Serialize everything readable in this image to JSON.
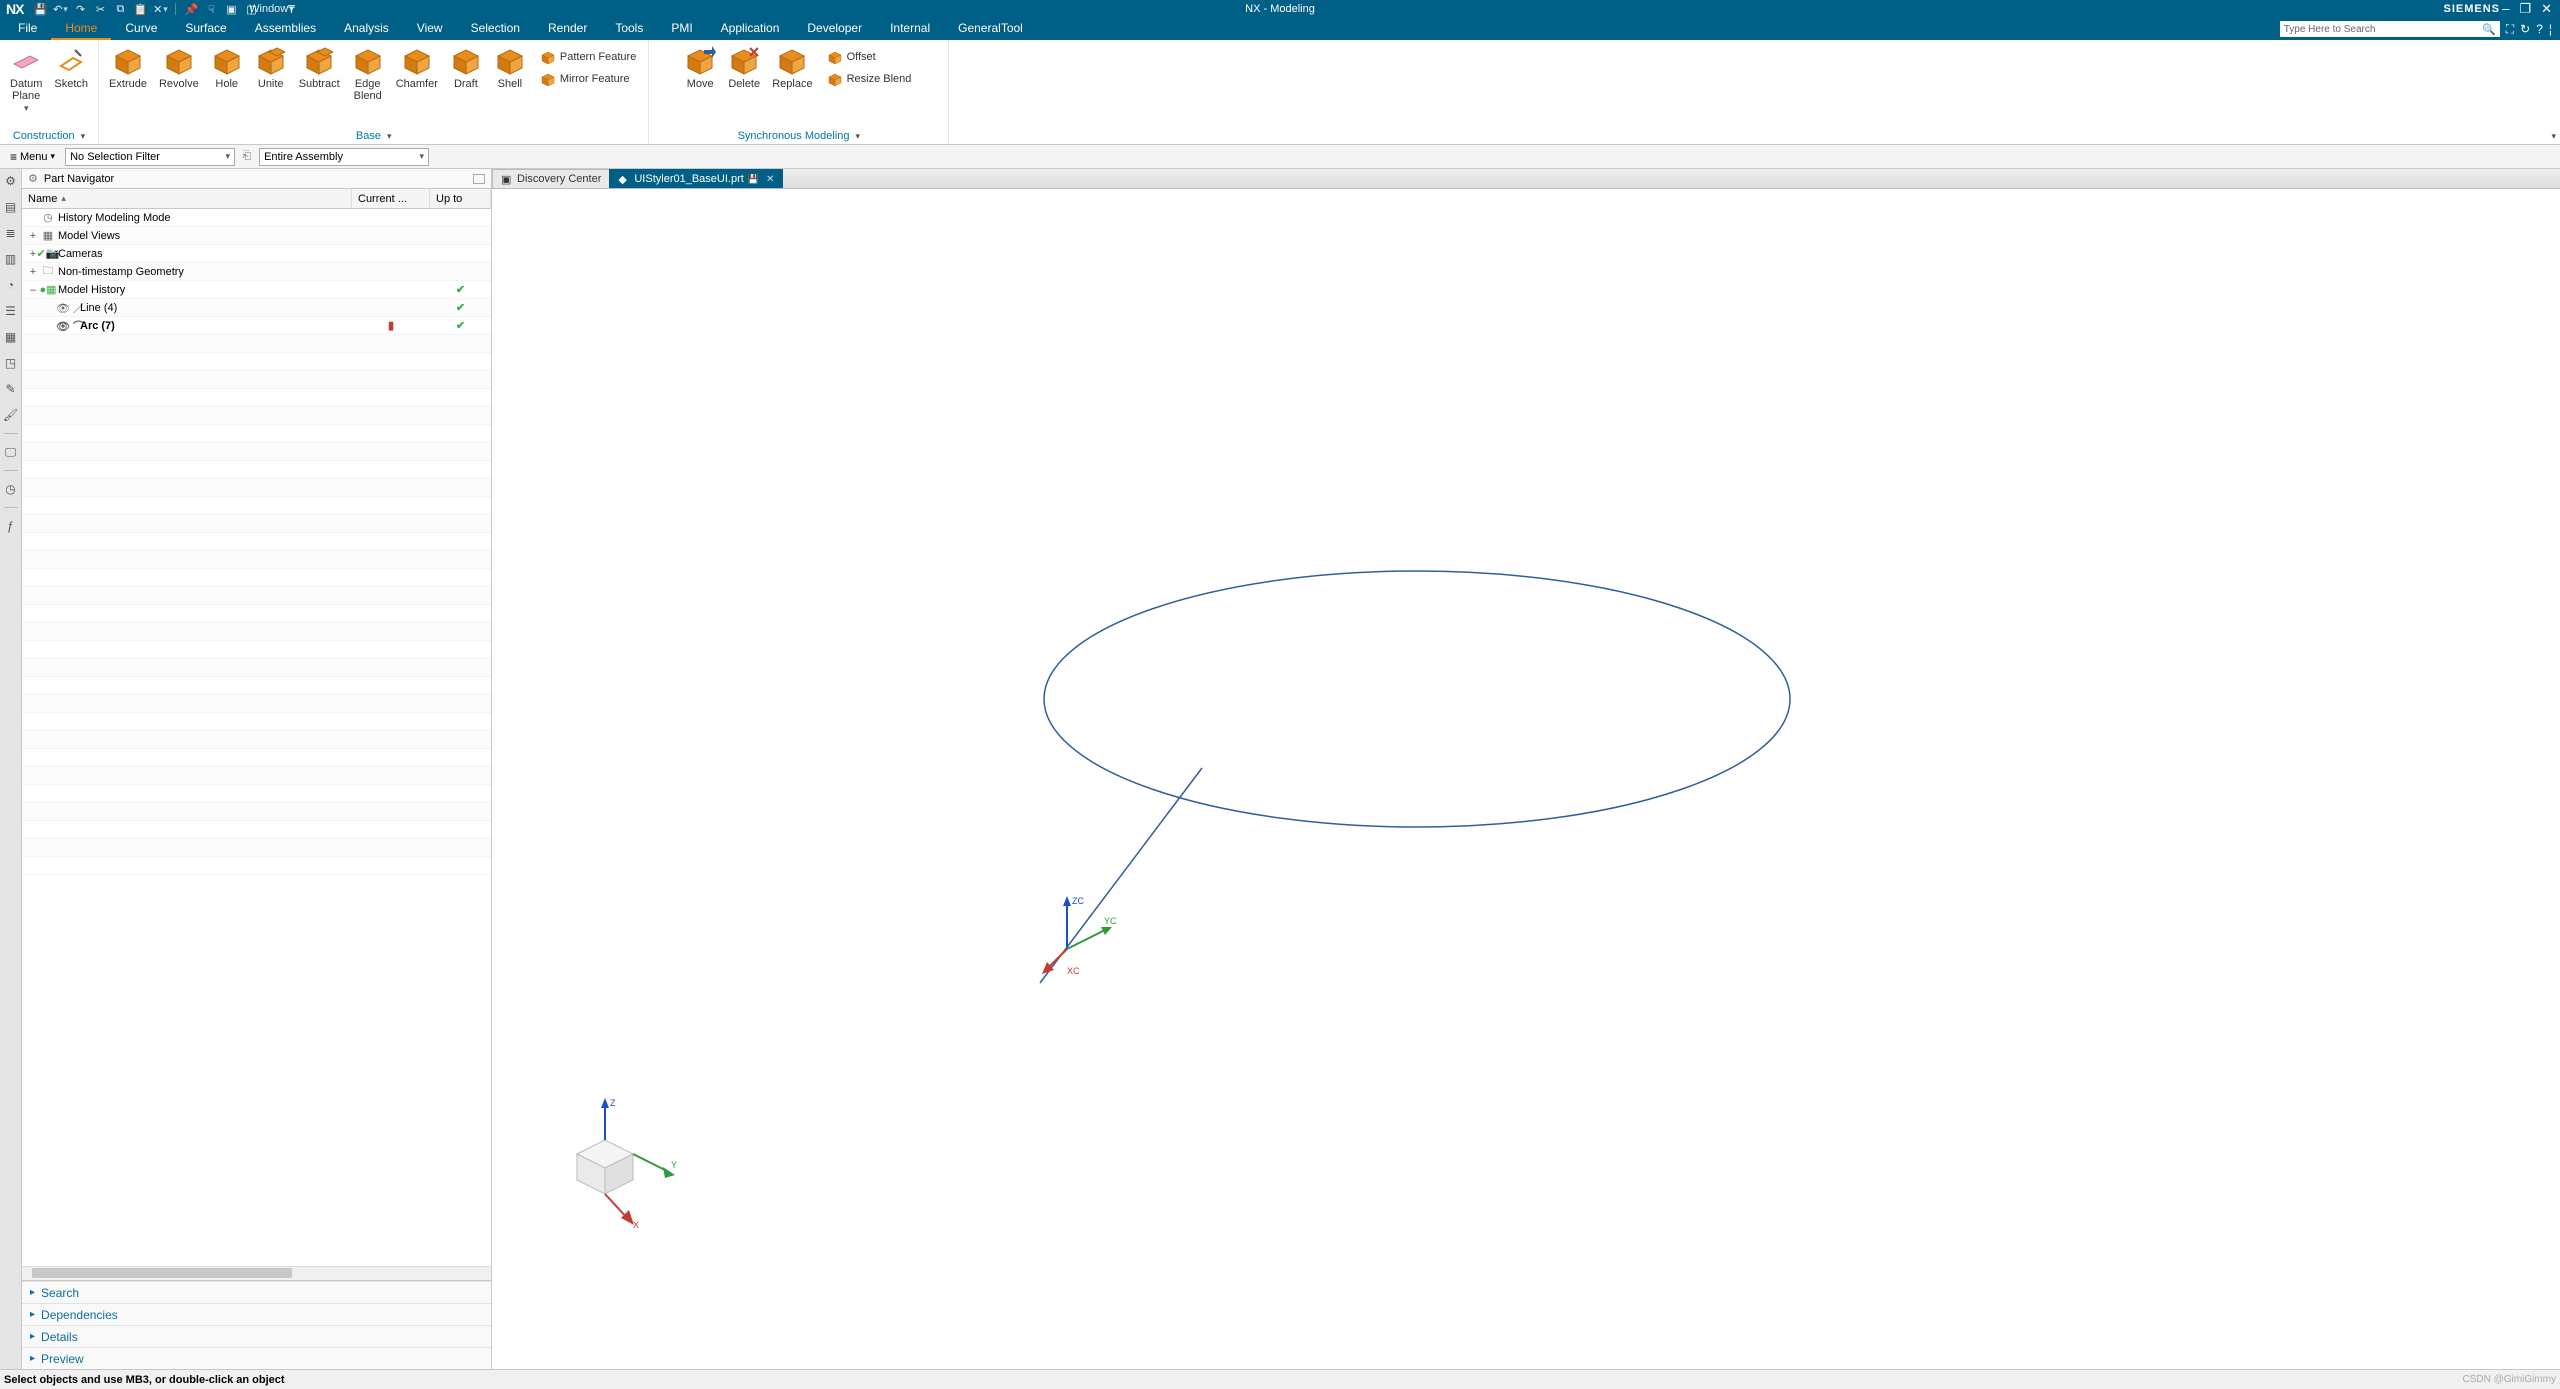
{
  "title_bar": {
    "app_logo": "NX",
    "qat": {
      "window_label": "Window",
      "icons": [
        "save-icon",
        "undo-icon",
        "redo-icon",
        "cut-icon",
        "copy-icon",
        "paste-icon",
        "close-x-icon",
        "sep",
        "pin-icon",
        "touch-icon",
        "layout1-icon",
        "layout2-icon"
      ]
    },
    "app_title": "NX - Modeling",
    "brand": "SIEMENS",
    "win_controls": [
      "–",
      "❐",
      "✕"
    ]
  },
  "menu_tabs": [
    "File",
    "Home",
    "Curve",
    "Surface",
    "Assemblies",
    "Analysis",
    "View",
    "Selection",
    "Render",
    "Tools",
    "PMI",
    "Application",
    "Developer",
    "Internal",
    "GeneralTool"
  ],
  "active_tab": "Home",
  "search": {
    "placeholder": "Type Here to Search"
  },
  "right_icons": [
    "fullscreen-icon",
    "recent-icon",
    "help-icon",
    "ham-menu-icon"
  ],
  "ribbon": {
    "groups": [
      {
        "name": "Construction",
        "label": "Construction",
        "large": [
          {
            "id": "datum-plane",
            "label": "Datum\nPlane",
            "caret": true,
            "style": "pink-plane"
          },
          {
            "id": "sketch",
            "label": "Sketch",
            "style": "sketch"
          }
        ]
      },
      {
        "name": "Base",
        "label": "Base",
        "large": [
          {
            "id": "extrude",
            "label": "Extrude",
            "style": "cube"
          },
          {
            "id": "revolve",
            "label": "Revolve",
            "style": "cube"
          },
          {
            "id": "hole",
            "label": "Hole",
            "style": "cube"
          },
          {
            "id": "unite",
            "label": "Unite",
            "style": "cubes"
          },
          {
            "id": "subtract",
            "label": "Subtract",
            "style": "cubes"
          },
          {
            "id": "edge-blend",
            "label": "Edge\nBlend",
            "style": "cube"
          },
          {
            "id": "chamfer",
            "label": "Chamfer",
            "style": "cube"
          },
          {
            "id": "draft",
            "label": "Draft",
            "style": "cube"
          },
          {
            "id": "shell",
            "label": "Shell",
            "style": "cube"
          }
        ],
        "small": [
          {
            "id": "pattern-feature",
            "label": "Pattern Feature"
          },
          {
            "id": "mirror-feature",
            "label": "Mirror Feature"
          }
        ]
      },
      {
        "name": "Synchronous",
        "label": "Synchronous Modeling",
        "large": [
          {
            "id": "move",
            "label": "Move",
            "style": "cube-arrow"
          },
          {
            "id": "delete",
            "label": "Delete",
            "style": "cube-x"
          },
          {
            "id": "replace",
            "label": "Replace",
            "style": "cube"
          }
        ],
        "small": [
          {
            "id": "offset",
            "label": "Offset"
          },
          {
            "id": "resize-blend",
            "label": "Resize Blend"
          }
        ]
      }
    ]
  },
  "filter_bar": {
    "menu": "Menu",
    "selection_filter": "No Selection Filter",
    "assembly_filter": "Entire Assembly"
  },
  "navigator": {
    "title": "Part Navigator",
    "columns": {
      "name": "Name",
      "current": "Current ...",
      "upto": "Up to"
    },
    "tree": [
      {
        "level": 0,
        "exp": "",
        "pre": "◷",
        "label": "History Modeling Mode",
        "check": ""
      },
      {
        "level": 0,
        "exp": "+",
        "pre": "▦",
        "label": "Model Views",
        "check": ""
      },
      {
        "level": 0,
        "exp": "+",
        "pre": "✔📷",
        "pre_color": "#3cb043",
        "label": "Cameras",
        "check": ""
      },
      {
        "level": 0,
        "exp": "+",
        "pre": "🗀",
        "label": "Non-timestamp Geometry",
        "check": ""
      },
      {
        "level": 0,
        "exp": "–",
        "pre": "●▦",
        "pre_color": "#3cb043",
        "label": "Model History",
        "check": "✔"
      },
      {
        "level": 1,
        "exp": "",
        "pre": "👁 ／",
        "label": "Line (4)",
        "check": "✔"
      },
      {
        "level": 1,
        "exp": "",
        "pre": "👁 ⌒",
        "label": "Arc (7)",
        "bold": true,
        "cur_icon": true,
        "check": "✔"
      }
    ],
    "footer_panels": [
      "Search",
      "Dependencies",
      "Details",
      "Preview"
    ]
  },
  "resource_icons": [
    "gear-icon",
    "nav-icon",
    "layers-icon",
    "playlist-icon",
    "history-icon",
    "tree-icon",
    "grid-icon",
    "clip-icon",
    "picker-icon",
    "paint-icon",
    "sep",
    "monitor-icon",
    "sep",
    "clock-icon",
    "sep",
    "var-icon"
  ],
  "doc_tabs": [
    {
      "id": "discovery",
      "label": "Discovery Center",
      "active": false
    },
    {
      "id": "file",
      "label": "UIStyler01_BaseUI.prt",
      "active": true,
      "closeable": true,
      "save_badge": true
    }
  ],
  "canvas": {
    "wcs_labels": {
      "x": "XC",
      "y": "YC",
      "z": "ZC"
    },
    "view_labels": {
      "x": "X",
      "y": "Y",
      "z": "Z"
    }
  },
  "status_bar": {
    "left": "Select objects and use MB3, or double-click an object",
    "right": "CSDN @GimiGimmy"
  }
}
